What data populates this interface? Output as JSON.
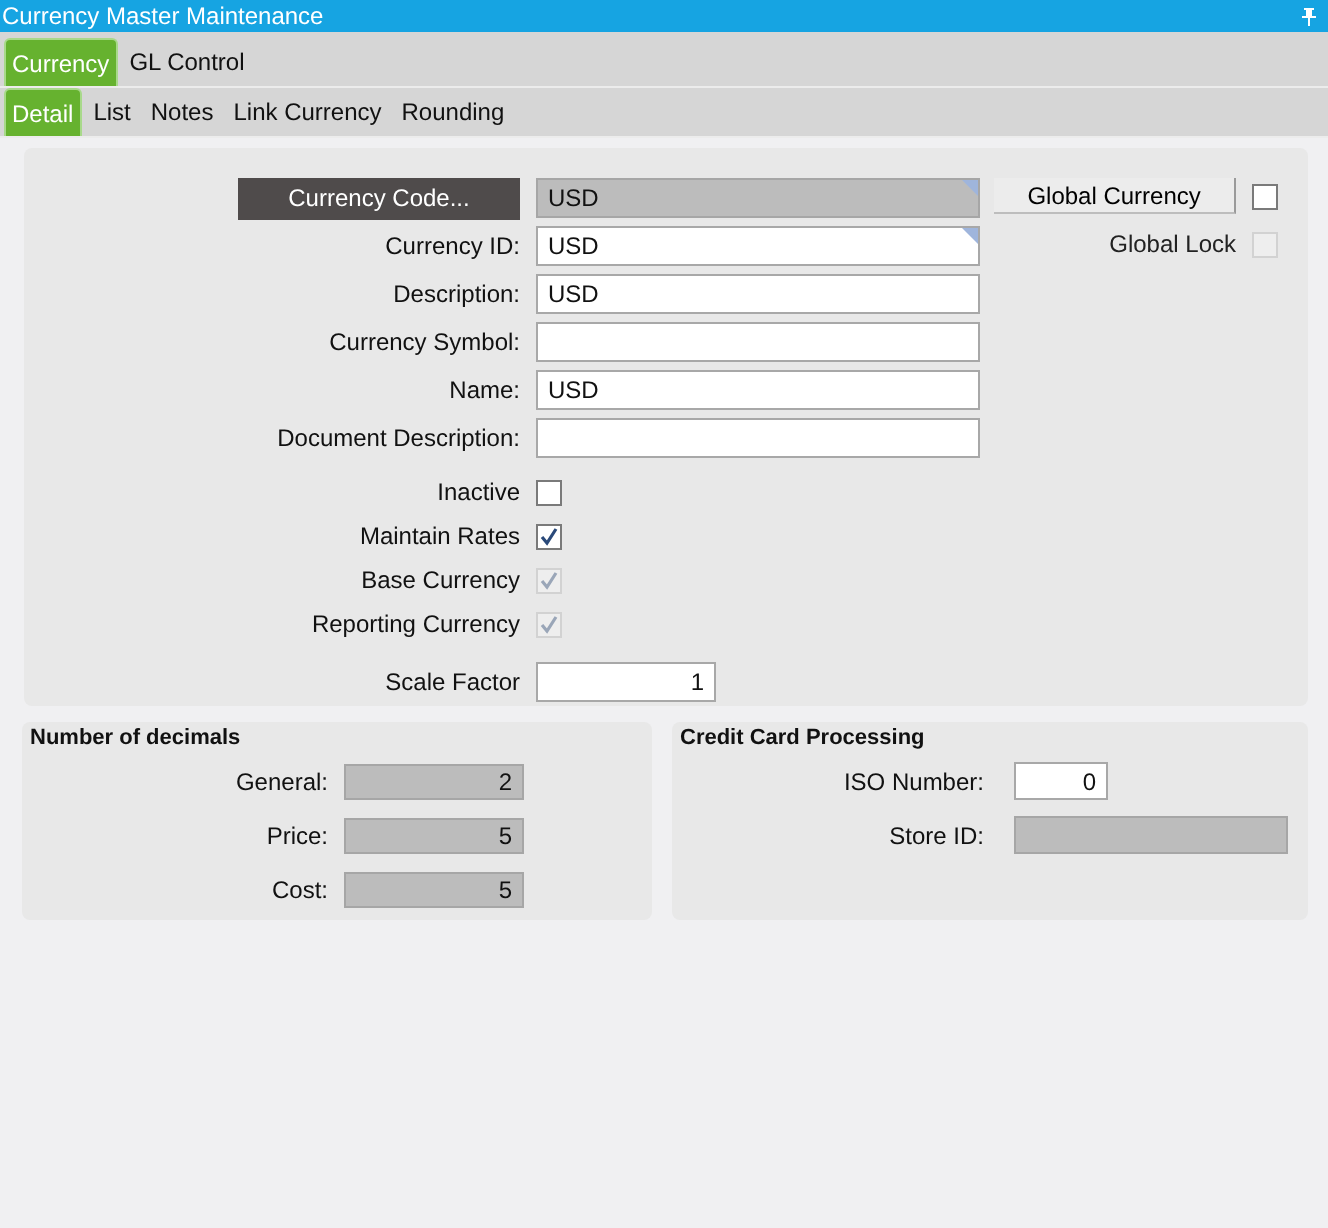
{
  "window": {
    "title": "Currency Master Maintenance"
  },
  "tabs": [
    {
      "label": "Currency",
      "selected": true
    },
    {
      "label": "GL Control",
      "selected": false
    }
  ],
  "subtabs": [
    {
      "label": "Detail",
      "selected": true
    },
    {
      "label": "List",
      "selected": false
    },
    {
      "label": "Notes",
      "selected": false
    },
    {
      "label": "Link Currency",
      "selected": false
    },
    {
      "label": "Rounding",
      "selected": false
    }
  ],
  "form": {
    "fields": [
      {
        "kind": "lookup",
        "label": "Currency Code...",
        "value": "USD",
        "flagged": true
      },
      {
        "kind": "text",
        "label": "Currency ID:",
        "value": "USD",
        "flagged": true
      },
      {
        "kind": "text",
        "label": "Description:",
        "value": "USD"
      },
      {
        "kind": "text",
        "label": "Currency Symbol:"
      },
      {
        "kind": "text",
        "label": "Name:",
        "value": "USD"
      },
      {
        "kind": "text",
        "label": "Document Description:"
      },
      {
        "kind": "checkbox",
        "label": "Inactive",
        "checked": false,
        "disabled": false
      },
      {
        "kind": "checkbox",
        "label": "Maintain Rates",
        "checked": true,
        "disabled": false
      },
      {
        "kind": "checkbox",
        "label": "Base Currency",
        "checked": true,
        "disabled": true
      },
      {
        "kind": "checkbox",
        "label": "Reporting Currency",
        "checked": true,
        "disabled": true
      },
      {
        "kind": "number",
        "label": "Scale Factor",
        "value": "1"
      }
    ],
    "global_currency": {
      "label": "Global Currency",
      "checked": false,
      "disabled": false
    },
    "global_lock": {
      "label": "Global Lock",
      "checked": false,
      "disabled": true
    }
  },
  "decimals": {
    "title": "Number of decimals",
    "fields": [
      {
        "label": "General:",
        "value": "2",
        "readonly": true
      },
      {
        "label": "Price:",
        "value": "5",
        "readonly": true
      },
      {
        "label": "Cost:",
        "value": "5",
        "readonly": true
      }
    ]
  },
  "credit_card": {
    "title": "Credit Card Processing",
    "fields": [
      {
        "label": "ISO Number:",
        "value": "0",
        "readonly": false
      },
      {
        "label": "Store ID:",
        "readonly": true
      }
    ]
  }
}
